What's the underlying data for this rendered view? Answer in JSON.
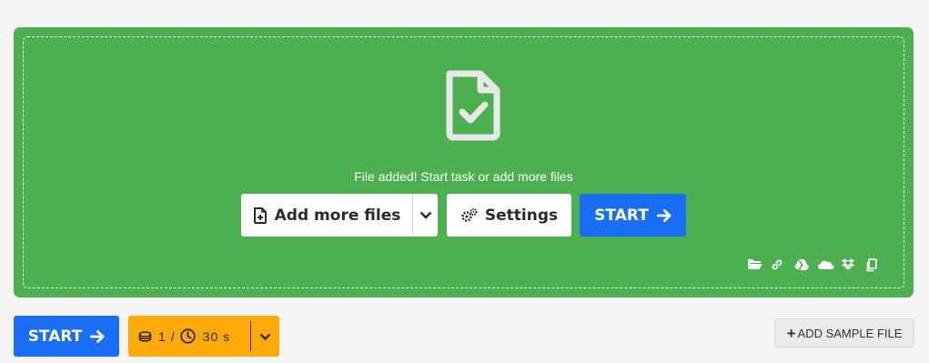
{
  "dropzone": {
    "status_text": "File added! Start task or add more files",
    "icons": {
      "file": "file-check-icon"
    }
  },
  "actions": {
    "add_files_label": "Add more files",
    "settings_label": "Settings",
    "start_label": "START"
  },
  "sources": [
    "folder-icon",
    "link-icon",
    "google-drive-icon",
    "onedrive-icon",
    "dropbox-icon",
    "clipboard-icon"
  ],
  "footer": {
    "start_label": "START",
    "credits_count": "1",
    "credits_separator": "/",
    "time_value": "30 s",
    "add_sample_label": "ADD SAMPLE FILE"
  },
  "colors": {
    "dropzone": "#4caf50",
    "primary": "#1a6ef5",
    "credits": "#ffa90a"
  }
}
